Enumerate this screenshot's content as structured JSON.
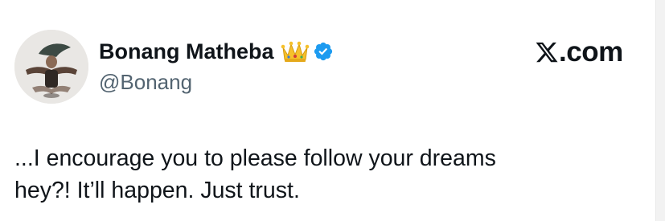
{
  "author": {
    "display_name": "Bonang Matheba",
    "handle": "@Bonang",
    "badges": [
      "crown-emoji-icon",
      "verified-badge-icon"
    ],
    "verified_color": "#1d9bf0"
  },
  "site": {
    "logo_label": "X",
    "domain_suffix": ".com"
  },
  "tweet": {
    "line1": "...I encourage you to please follow your dreams",
    "line2": "hey?! It’ll happen. Just trust."
  },
  "colors": {
    "text": "#0f1419",
    "secondary": "#536471",
    "background": "#ffffff"
  }
}
